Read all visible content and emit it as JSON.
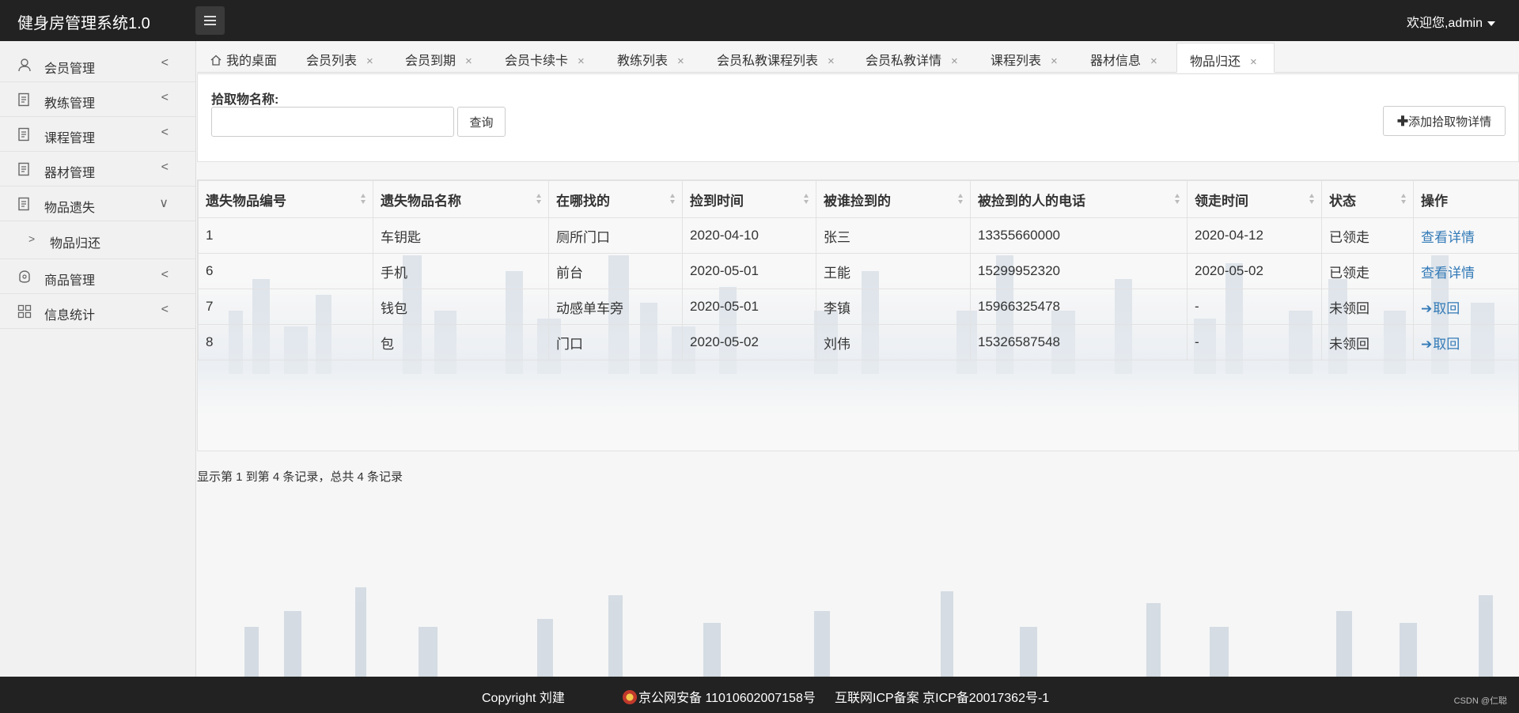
{
  "app": {
    "title": "健身房管理系统1.0",
    "welcome": "欢迎您,admin"
  },
  "sidebar": {
    "items": [
      {
        "label": "会员管理",
        "chevron": "<"
      },
      {
        "label": "教练管理",
        "chevron": "<"
      },
      {
        "label": "课程管理",
        "chevron": "<"
      },
      {
        "label": "器材管理",
        "chevron": "<"
      },
      {
        "label": "物品遗失",
        "chevron": "∨"
      },
      {
        "label": "商品管理",
        "chevron": "<"
      },
      {
        "label": "信息统计",
        "chevron": "<"
      }
    ],
    "sub": {
      "label": "物品归还",
      "arrow": ">"
    }
  },
  "tabs": [
    {
      "label": "我的桌面"
    },
    {
      "label": "会员列表"
    },
    {
      "label": "会员到期"
    },
    {
      "label": "会员卡续卡"
    },
    {
      "label": "教练列表"
    },
    {
      "label": "会员私教课程列表"
    },
    {
      "label": "会员私教详情"
    },
    {
      "label": "课程列表"
    },
    {
      "label": "器材信息"
    },
    {
      "label": "物品归还"
    }
  ],
  "tab_close": "×",
  "search": {
    "label": "拾取物名称:",
    "value": "",
    "query_button": "查询",
    "add_button": "添加拾取物详情"
  },
  "table": {
    "headers": [
      "遗失物品编号",
      "遗失物品名称",
      "在哪找的",
      "捡到时间",
      "被谁捡到的",
      "被捡到的人的电话",
      "领走时间",
      "状态",
      "操作"
    ],
    "rows": [
      [
        "1",
        "车钥匙",
        "厕所门口",
        "2020-04-10",
        "张三",
        "13355660000",
        "2020-04-12",
        "已领走",
        "查看详情"
      ],
      [
        "6",
        "手机",
        "前台",
        "2020-05-01",
        "王能",
        "15299952320",
        "2020-05-02",
        "已领走",
        "查看详情"
      ],
      [
        "7",
        "钱包",
        "动感单车旁",
        "2020-05-01",
        "李镇",
        "15966325478",
        "-",
        "未领回",
        "取回"
      ],
      [
        "8",
        "包",
        "门口",
        "2020-05-02",
        "刘伟",
        "15326587548",
        "-",
        "未领回",
        "取回"
      ]
    ]
  },
  "pager": {
    "info": "显示第 1 到第 4 条记录，总共 4 条记录"
  },
  "footer": {
    "copyright": "Copyright 刘建",
    "beian": "京公网安备 11010602007158号",
    "icp": "互联网ICP备案 京ICP备20017362号-1",
    "csdn": "CSDN @仁聪"
  },
  "colors": {
    "topbar": "#222222",
    "link": "#337ab7",
    "sidebar_bg": "#f1f1f1"
  }
}
